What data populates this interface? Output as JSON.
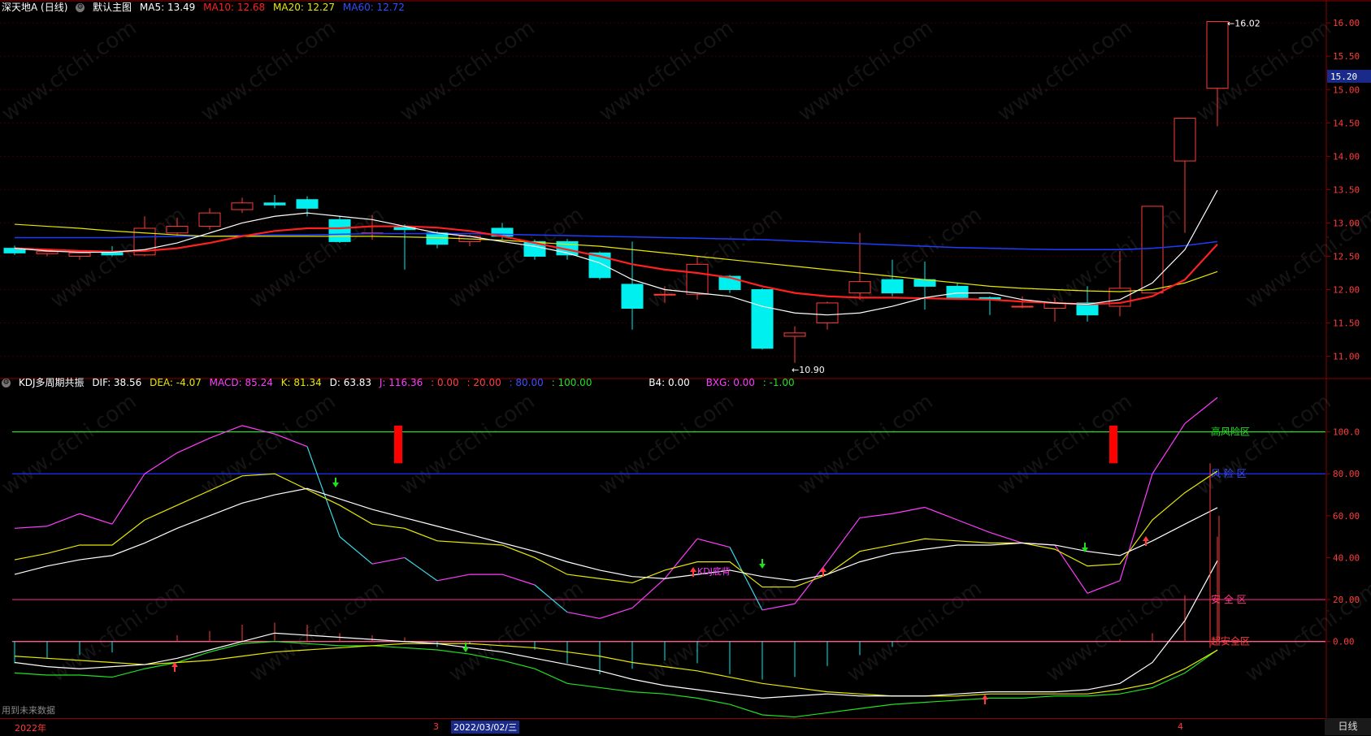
{
  "main_header": {
    "stock": "深天地A (日线)",
    "template": "默认主图",
    "ma5": "MA5: 13.49",
    "ma10": "MA10: 12.68",
    "ma20": "MA20: 12.27",
    "ma60": "MA60: 12.72",
    "colors": {
      "ma5": "#ffffff",
      "ma10": "#ff2020",
      "ma20": "#e8e800",
      "ma60": "#1e3cff"
    }
  },
  "sub_header": {
    "name": "KDJ多周期共振",
    "dif": "DIF: 38.56",
    "dea": "DEA: -4.07",
    "macd": "MACD: 85.24",
    "k": "K: 81.34",
    "d": "D: 63.83",
    "j": "J: 116.36",
    "v1": ": 0.00",
    "v2": ": 20.00",
    "v3": ": 80.00",
    "v4": ": 100.00",
    "b4": "B4: 0.00",
    "bxg": "BXG: 0.00",
    "v5": ": -1.00"
  },
  "price_axis": [
    "16.00",
    "15.50",
    "15.00",
    "14.50",
    "14.00",
    "13.50",
    "13.00",
    "12.50",
    "12.00",
    "11.50",
    "11.00"
  ],
  "current_price": "15.20",
  "high_label": "16.02",
  "low_label": "10.90",
  "kdj_axis": [
    "100.0",
    "80.00",
    "60.00",
    "40.00",
    "20.00",
    "0.00"
  ],
  "zone_labels": [
    "高风险区",
    "风 险 区",
    "安 全 区",
    "超安全区"
  ],
  "kdj_label": "KDJ底背",
  "bottom_note": "用到未来数据",
  "timebar": {
    "year": "2022年",
    "m3": "3",
    "cursor_date": "2022/03/02/三",
    "m4": "4"
  },
  "period_button": "日线",
  "watermark": "www.cfchi.com",
  "chart_data": {
    "type": "candlestick",
    "dates_shown": [
      "2022年",
      "3",
      "4"
    ],
    "ylim": [
      10.8,
      16.1
    ],
    "candles": [
      {
        "o": 12.62,
        "c": 12.55,
        "h": 12.66,
        "l": 12.52
      },
      {
        "o": 12.54,
        "c": 12.57,
        "h": 12.6,
        "l": 12.5
      },
      {
        "o": 12.5,
        "c": 12.55,
        "h": 12.58,
        "l": 12.45
      },
      {
        "o": 12.56,
        "c": 12.52,
        "h": 12.65,
        "l": 12.5
      },
      {
        "o": 12.52,
        "c": 12.92,
        "h": 13.1,
        "l": 12.5
      },
      {
        "o": 12.85,
        "c": 12.95,
        "h": 13.08,
        "l": 12.8
      },
      {
        "o": 12.95,
        "c": 13.15,
        "h": 13.22,
        "l": 12.9
      },
      {
        "o": 13.2,
        "c": 13.3,
        "h": 13.38,
        "l": 13.15
      },
      {
        "o": 13.3,
        "c": 13.27,
        "h": 13.42,
        "l": 13.22
      },
      {
        "o": 13.35,
        "c": 13.22,
        "h": 13.4,
        "l": 13.1
      },
      {
        "o": 13.05,
        "c": 12.72,
        "h": 13.1,
        "l": 12.7
      },
      {
        "o": 12.85,
        "c": 12.85,
        "h": 13.12,
        "l": 12.75
      },
      {
        "o": 12.95,
        "c": 12.9,
        "h": 12.98,
        "l": 12.3
      },
      {
        "o": 12.85,
        "c": 12.68,
        "h": 12.88,
        "l": 12.62
      },
      {
        "o": 12.72,
        "c": 12.8,
        "h": 12.82,
        "l": 12.65
      },
      {
        "o": 12.92,
        "c": 12.8,
        "h": 13.0,
        "l": 12.75
      },
      {
        "o": 12.72,
        "c": 12.5,
        "h": 12.75,
        "l": 12.45
      },
      {
        "o": 12.72,
        "c": 12.52,
        "h": 12.76,
        "l": 12.45
      },
      {
        "o": 12.55,
        "c": 12.18,
        "h": 12.57,
        "l": 12.15
      },
      {
        "o": 12.08,
        "c": 11.72,
        "h": 12.72,
        "l": 11.4
      },
      {
        "o": 11.93,
        "c": 11.93,
        "h": 12.05,
        "l": 11.8
      },
      {
        "o": 11.93,
        "c": 12.38,
        "h": 12.5,
        "l": 11.85
      },
      {
        "o": 12.2,
        "c": 12.0,
        "h": 12.22,
        "l": 11.95
      },
      {
        "o": 12.0,
        "c": 11.12,
        "h": 12.02,
        "l": 11.1
      },
      {
        "o": 11.3,
        "c": 11.35,
        "h": 11.45,
        "l": 10.9
      },
      {
        "o": 11.5,
        "c": 11.8,
        "h": 11.82,
        "l": 11.4
      },
      {
        "o": 11.95,
        "c": 12.12,
        "h": 12.85,
        "l": 11.85
      },
      {
        "o": 12.15,
        "c": 11.95,
        "h": 12.45,
        "l": 11.9
      },
      {
        "o": 12.15,
        "c": 12.05,
        "h": 12.42,
        "l": 11.7
      },
      {
        "o": 12.05,
        "c": 11.88,
        "h": 12.1,
        "l": 11.85
      },
      {
        "o": 11.88,
        "c": 11.85,
        "h": 11.9,
        "l": 11.62
      },
      {
        "o": 11.75,
        "c": 11.75,
        "h": 11.9,
        "l": 11.72
      },
      {
        "o": 11.72,
        "c": 11.8,
        "h": 11.88,
        "l": 11.52
      },
      {
        "o": 11.8,
        "c": 11.62,
        "h": 12.05,
        "l": 11.52
      },
      {
        "o": 11.75,
        "c": 12.02,
        "h": 12.58,
        "l": 11.6
      },
      {
        "o": 11.95,
        "c": 13.25,
        "h": 13.25,
        "l": 11.95
      },
      {
        "o": 13.93,
        "c": 14.57,
        "h": 14.57,
        "l": 12.85
      },
      {
        "o": 15.02,
        "c": 16.02,
        "h": 16.02,
        "l": 14.45
      }
    ],
    "ma5": [
      12.62,
      12.58,
      12.56,
      12.56,
      12.6,
      12.7,
      12.85,
      13.0,
      13.1,
      13.15,
      13.1,
      13.05,
      12.95,
      12.85,
      12.8,
      12.72,
      12.65,
      12.55,
      12.4,
      12.15,
      12.0,
      11.95,
      11.9,
      11.75,
      11.65,
      11.62,
      11.65,
      11.75,
      11.88,
      11.95,
      11.95,
      11.85,
      11.8,
      11.78,
      11.85,
      12.1,
      12.6,
      13.49
    ],
    "ma10": [
      12.62,
      12.6,
      12.58,
      12.57,
      12.58,
      12.62,
      12.7,
      12.8,
      12.88,
      12.92,
      12.92,
      12.95,
      12.95,
      12.93,
      12.88,
      12.8,
      12.7,
      12.6,
      12.5,
      12.38,
      12.3,
      12.25,
      12.18,
      12.05,
      11.95,
      11.9,
      11.88,
      11.88,
      11.87,
      11.86,
      11.85,
      11.82,
      11.8,
      11.78,
      11.8,
      11.9,
      12.15,
      12.68
    ],
    "ma20": [
      12.98,
      12.95,
      12.92,
      12.88,
      12.85,
      12.82,
      12.8,
      12.8,
      12.8,
      12.8,
      12.8,
      12.8,
      12.79,
      12.78,
      12.76,
      12.74,
      12.71,
      12.68,
      12.65,
      12.6,
      12.55,
      12.5,
      12.45,
      12.4,
      12.35,
      12.3,
      12.25,
      12.2,
      12.15,
      12.1,
      12.05,
      12.02,
      12.0,
      11.98,
      11.97,
      12.0,
      12.1,
      12.27
    ],
    "ma60": [
      12.78,
      12.78,
      12.78,
      12.78,
      12.79,
      12.8,
      12.8,
      12.81,
      12.82,
      12.82,
      12.83,
      12.84,
      12.84,
      12.84,
      12.84,
      12.83,
      12.82,
      12.81,
      12.8,
      12.79,
      12.78,
      12.77,
      12.76,
      12.75,
      12.73,
      12.71,
      12.69,
      12.67,
      12.65,
      12.63,
      12.62,
      12.61,
      12.6,
      12.6,
      12.6,
      12.62,
      12.66,
      12.72
    ],
    "kdj": {
      "k": [
        32,
        36,
        39,
        41,
        47,
        54,
        60,
        66,
        70,
        73,
        68,
        63,
        59,
        55,
        51,
        47,
        43,
        38,
        34,
        31,
        30,
        32,
        34,
        31,
        29,
        32,
        38,
        42,
        44,
        46,
        46,
        47,
        46,
        43,
        41,
        48,
        56,
        63.83
      ],
      "d": [
        39,
        42,
        46,
        46,
        58,
        65,
        72,
        79,
        80,
        null,
        65,
        56,
        54,
        48,
        47,
        46,
        40,
        32,
        30,
        28,
        34,
        38,
        38,
        26,
        26,
        32,
        43,
        46,
        49,
        48,
        47,
        47,
        44,
        36,
        37,
        58,
        71,
        81.34
      ],
      "j": [
        54,
        55,
        61,
        56,
        80,
        90,
        97,
        103,
        99,
        93,
        50,
        37,
        40,
        29,
        32,
        32,
        27,
        14,
        11,
        16,
        30,
        49,
        45,
        15,
        18,
        38,
        59,
        61,
        64,
        58,
        52,
        47,
        46,
        23,
        29,
        80,
        104,
        116.36
      ]
    },
    "macd_like": {
      "white": [
        -10,
        -12,
        -13,
        -12,
        -11,
        -8,
        -4,
        0,
        4,
        3,
        2,
        1,
        0,
        -1,
        -3,
        -5,
        -8,
        -11,
        -14,
        -18,
        -21,
        -23,
        -25,
        -27,
        -26,
        -25,
        -26,
        -26,
        -26,
        -25,
        -24,
        -24,
        -24,
        -23,
        -20,
        -10,
        10,
        38.56
      ],
      "yellow": [
        -7,
        -8,
        -9,
        -10,
        -11,
        -10,
        -9,
        -7,
        -5,
        -4,
        -3,
        -2,
        -1,
        -1,
        -1,
        -2,
        -3,
        -5,
        -7,
        -10,
        -12,
        -14,
        -17,
        -20,
        -22,
        -24,
        -25,
        -26,
        -26,
        -26,
        -25,
        -25,
        -25,
        -25,
        -23,
        -20,
        -13,
        -4.07
      ],
      "green": [
        -15,
        -16,
        -16,
        -17,
        -13,
        -10,
        -5,
        -1,
        0,
        -1,
        -2,
        -2,
        -3,
        -4,
        -6,
        -9,
        -13,
        -20,
        -22,
        -24,
        -25,
        -27,
        -30,
        -35,
        -36,
        -34,
        -32,
        -30,
        -29,
        -28,
        -27,
        -27,
        -26,
        -26,
        -25,
        -22,
        -15,
        -4
      ]
    }
  }
}
